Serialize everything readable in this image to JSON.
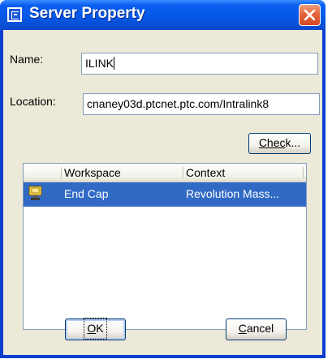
{
  "window": {
    "title": "Server Property"
  },
  "form": {
    "name_label": "Name:",
    "name_value": "ILINK",
    "location_label": "Location:",
    "location_value": "cnaney03d.ptcnet.ptc.com/Intralink8"
  },
  "buttons": {
    "check_underlined": "Chec",
    "check_rest": "k...",
    "ok_underlined": "O",
    "ok_rest": "K",
    "cancel_underlined": "C",
    "cancel_rest": "ancel"
  },
  "list": {
    "columns": [
      "Workspace",
      "Context"
    ],
    "rows": [
      {
        "workspace": "End Cap",
        "context": "Revolution Mass...",
        "selected": true,
        "icon": "workspace-icon"
      }
    ]
  },
  "colors": {
    "titlebar": "#0558e6",
    "selection": "#316ac5",
    "dialog_face": "#ece9d8",
    "close_button": "#e4643e"
  }
}
